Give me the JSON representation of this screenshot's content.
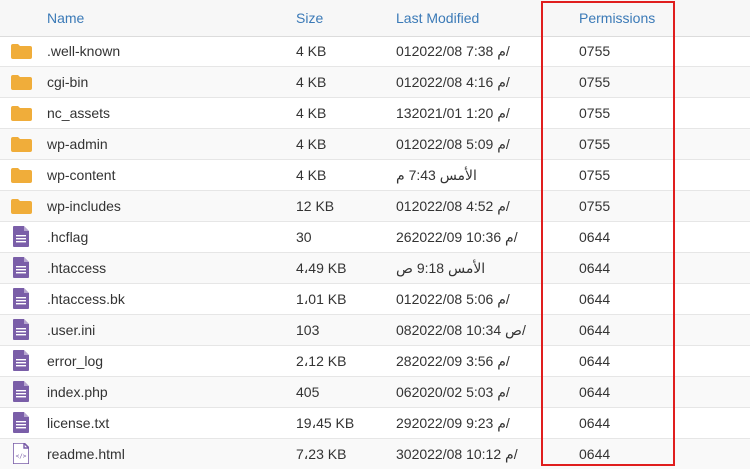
{
  "header": {
    "name": "Name",
    "size": "Size",
    "last_modified": "Last Modified",
    "permissions": "Permissions"
  },
  "colors": {
    "header_link": "#3b7ab7",
    "folder": "#f0ad3a",
    "file": "#7a5ea8",
    "highlight": "#e01e1e"
  },
  "files": [
    {
      "icon": "folder-icon",
      "name": ".well-known",
      "size": "4 KB",
      "modified": "01م 7:38 2022/08/",
      "perms": "0755"
    },
    {
      "icon": "folder-icon",
      "name": "cgi-bin",
      "size": "4 KB",
      "modified": "01م 4:16 2022/08/",
      "perms": "0755"
    },
    {
      "icon": "folder-icon",
      "name": "nc_assets",
      "size": "4 KB",
      "modified": "13م 1:20 2021/01/",
      "perms": "0755"
    },
    {
      "icon": "folder-icon",
      "name": "wp-admin",
      "size": "4 KB",
      "modified": "01م 5:09 2022/08/",
      "perms": "0755"
    },
    {
      "icon": "folder-icon",
      "name": "wp-content",
      "size": "4 KB",
      "modified": "الأمس 7:43 م",
      "perms": "0755"
    },
    {
      "icon": "folder-icon",
      "name": "wp-includes",
      "size": "12 KB",
      "modified": "01م 4:52 2022/08/",
      "perms": "0755"
    },
    {
      "icon": "file-icon",
      "name": ".hcflag",
      "size": "30",
      "modified": "26م 10:36 2022/09/",
      "perms": "0644"
    },
    {
      "icon": "file-icon",
      "name": ".htaccess",
      "size": "4،49 KB",
      "modified": "الأمس 9:18 ص",
      "perms": "0644"
    },
    {
      "icon": "file-icon",
      "name": ".htaccess.bk",
      "size": "1،01 KB",
      "modified": "01م 5:06 2022/08/",
      "perms": "0644"
    },
    {
      "icon": "file-icon",
      "name": ".user.ini",
      "size": "103",
      "modified": "08ص 10:34 2022/08/",
      "perms": "0644"
    },
    {
      "icon": "file-icon",
      "name": "error_log",
      "size": "2،12 KB",
      "modified": "28م 3:56 2022/09/",
      "perms": "0644"
    },
    {
      "icon": "file-icon",
      "name": "index.php",
      "size": "405",
      "modified": "06م 5:03 2020/02/",
      "perms": "0644"
    },
    {
      "icon": "file-icon",
      "name": "license.txt",
      "size": "19،45 KB",
      "modified": "29م 9:23 2022/09/",
      "perms": "0644"
    },
    {
      "icon": "code-file-icon",
      "name": "readme.html",
      "size": "7،23 KB",
      "modified": "30م 10:12 2022/08/",
      "perms": "0644"
    }
  ]
}
